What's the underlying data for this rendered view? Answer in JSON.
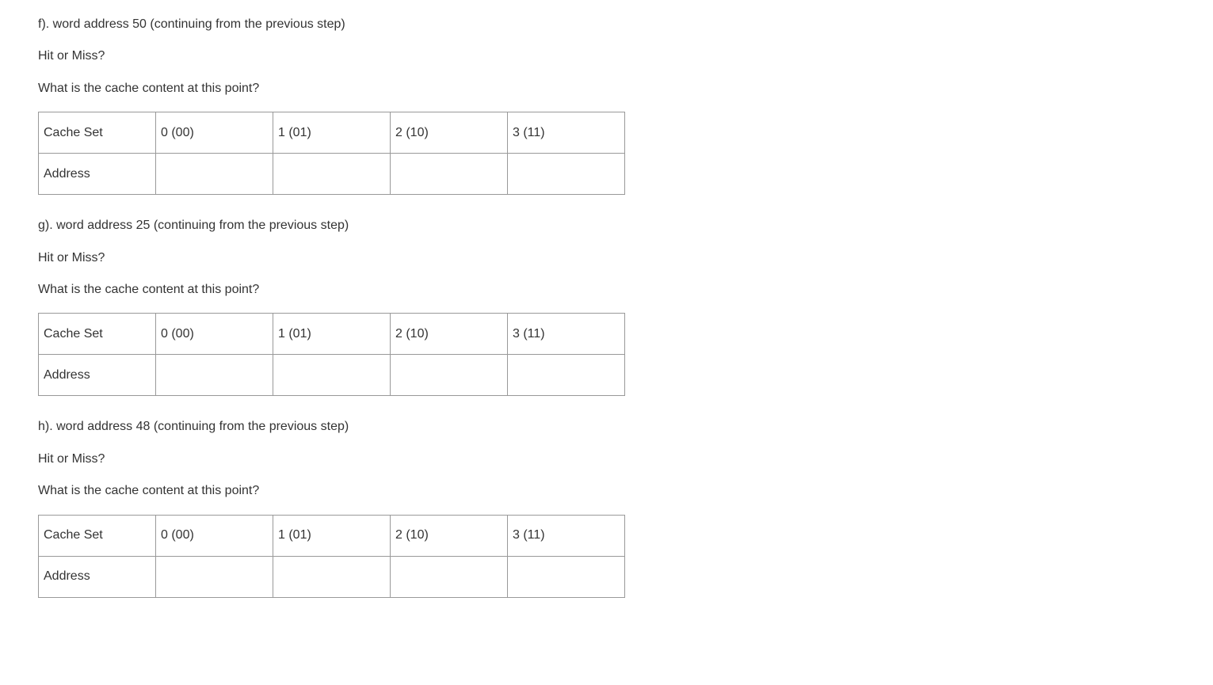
{
  "common": {
    "hit_or_miss": "Hit or Miss?",
    "cache_content_q": "What is the cache content at this point?",
    "row_label_set": "Cache Set",
    "row_label_addr": "Address",
    "cols": [
      "0 (00)",
      "1 (01)",
      "2 (10)",
      "3 (11)"
    ]
  },
  "sections": {
    "f": {
      "prompt": "f). word address 50  (continuing from the previous step)",
      "addr": [
        "",
        "",
        "",
        ""
      ]
    },
    "g": {
      "prompt": "g). word address 25  (continuing from the previous step)",
      "addr": [
        "",
        "",
        "",
        ""
      ]
    },
    "h": {
      "prompt": "h). word address 48  (continuing from the previous step)",
      "addr": [
        "",
        "",
        "",
        ""
      ]
    }
  }
}
